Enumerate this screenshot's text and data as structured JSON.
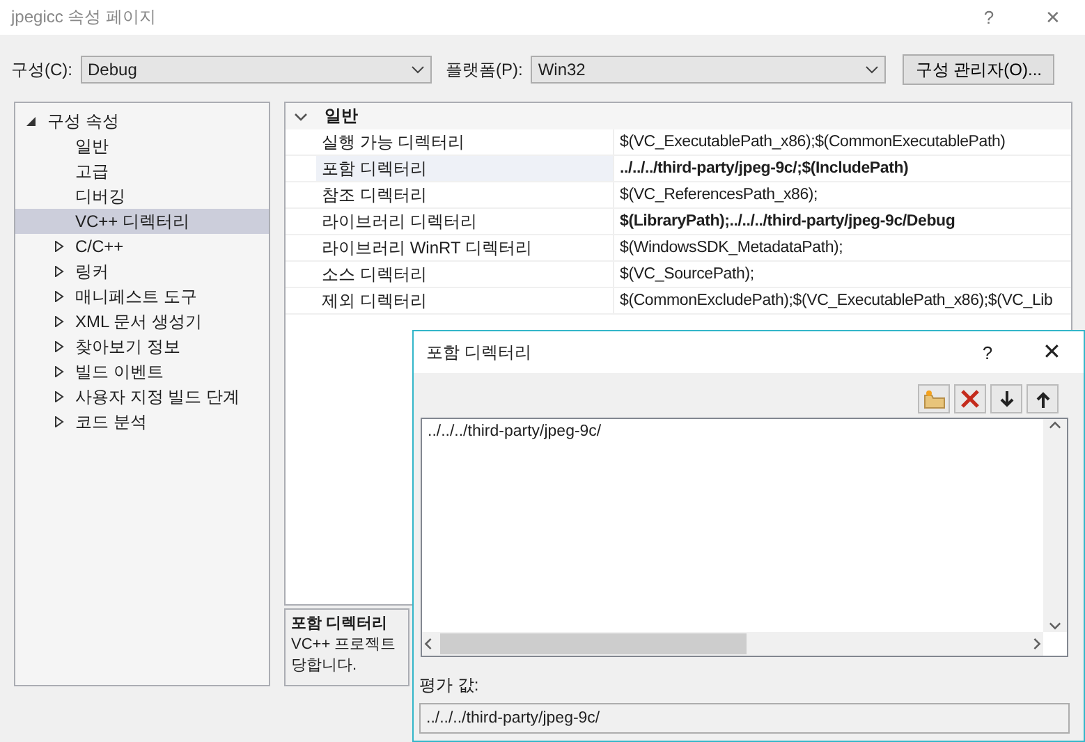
{
  "window": {
    "title": "jpegicc 속성 페이지",
    "help": "?",
    "close": "✕"
  },
  "toolbar": {
    "configuration": {
      "label": "구성(C):",
      "value": "Debug"
    },
    "platform": {
      "label": "플랫폼(P):",
      "value": "Win32"
    },
    "manager_button": "구성 관리자(O)..."
  },
  "tree": [
    {
      "label": "구성 속성",
      "kind": "folder",
      "expanded": true,
      "selected": false,
      "children": [
        {
          "label": "일반",
          "kind": "leaf",
          "selected": false
        },
        {
          "label": "고급",
          "kind": "leaf",
          "selected": false
        },
        {
          "label": "디버깅",
          "kind": "leaf",
          "selected": false
        },
        {
          "label": "VC++ 디렉터리",
          "kind": "leaf",
          "selected": true
        },
        {
          "label": "C/C++",
          "kind": "folder",
          "expanded": false,
          "selected": false
        },
        {
          "label": "링커",
          "kind": "folder",
          "expanded": false,
          "selected": false
        },
        {
          "label": "매니페스트 도구",
          "kind": "folder",
          "expanded": false,
          "selected": false
        },
        {
          "label": "XML 문서 생성기",
          "kind": "folder",
          "expanded": false,
          "selected": false
        },
        {
          "label": "찾아보기 정보",
          "kind": "folder",
          "expanded": false,
          "selected": false
        },
        {
          "label": "빌드 이벤트",
          "kind": "folder",
          "expanded": false,
          "selected": false
        },
        {
          "label": "사용자 지정 빌드 단계",
          "kind": "folder",
          "expanded": false,
          "selected": false
        },
        {
          "label": "코드 분석",
          "kind": "folder",
          "expanded": false,
          "selected": false
        }
      ]
    }
  ],
  "grid": {
    "group": {
      "label": "일반",
      "expanded": true
    },
    "rows": [
      {
        "name": "실행 가능 디렉터리",
        "value": "$(VC_ExecutablePath_x86);$(CommonExecutablePath)",
        "bold": false,
        "selected": false
      },
      {
        "name": "포함 디렉터리",
        "value": "../../../third-party/jpeg-9c/;$(IncludePath)",
        "bold": true,
        "selected": true
      },
      {
        "name": "참조 디렉터리",
        "value": "$(VC_ReferencesPath_x86);",
        "bold": false,
        "selected": false
      },
      {
        "name": "라이브러리 디렉터리",
        "value": "$(LibraryPath);../../../third-party/jpeg-9c/Debug",
        "bold": true,
        "selected": false
      },
      {
        "name": "라이브러리 WinRT 디렉터리",
        "value": "$(WindowsSDK_MetadataPath);",
        "bold": false,
        "selected": false
      },
      {
        "name": "소스 디렉터리",
        "value": "$(VC_SourcePath);",
        "bold": false,
        "selected": false
      },
      {
        "name": "제외 디렉터리",
        "value": "$(CommonExcludePath);$(VC_ExecutablePath_x86);$(VC_Lib",
        "bold": false,
        "selected": false
      }
    ]
  },
  "description": {
    "title": "포함 디렉터리",
    "lines": [
      "VC++ 프로젝트",
      "당합니다."
    ]
  },
  "dialog": {
    "title": "포함 디렉터리",
    "help": "?",
    "close": "✕",
    "entries": [
      {
        "text": "../../../third-party/jpeg-9c/",
        "selected": false
      }
    ],
    "evaluated_label": "평가 값:",
    "evaluated_value": "../../../third-party/jpeg-9c/"
  }
}
